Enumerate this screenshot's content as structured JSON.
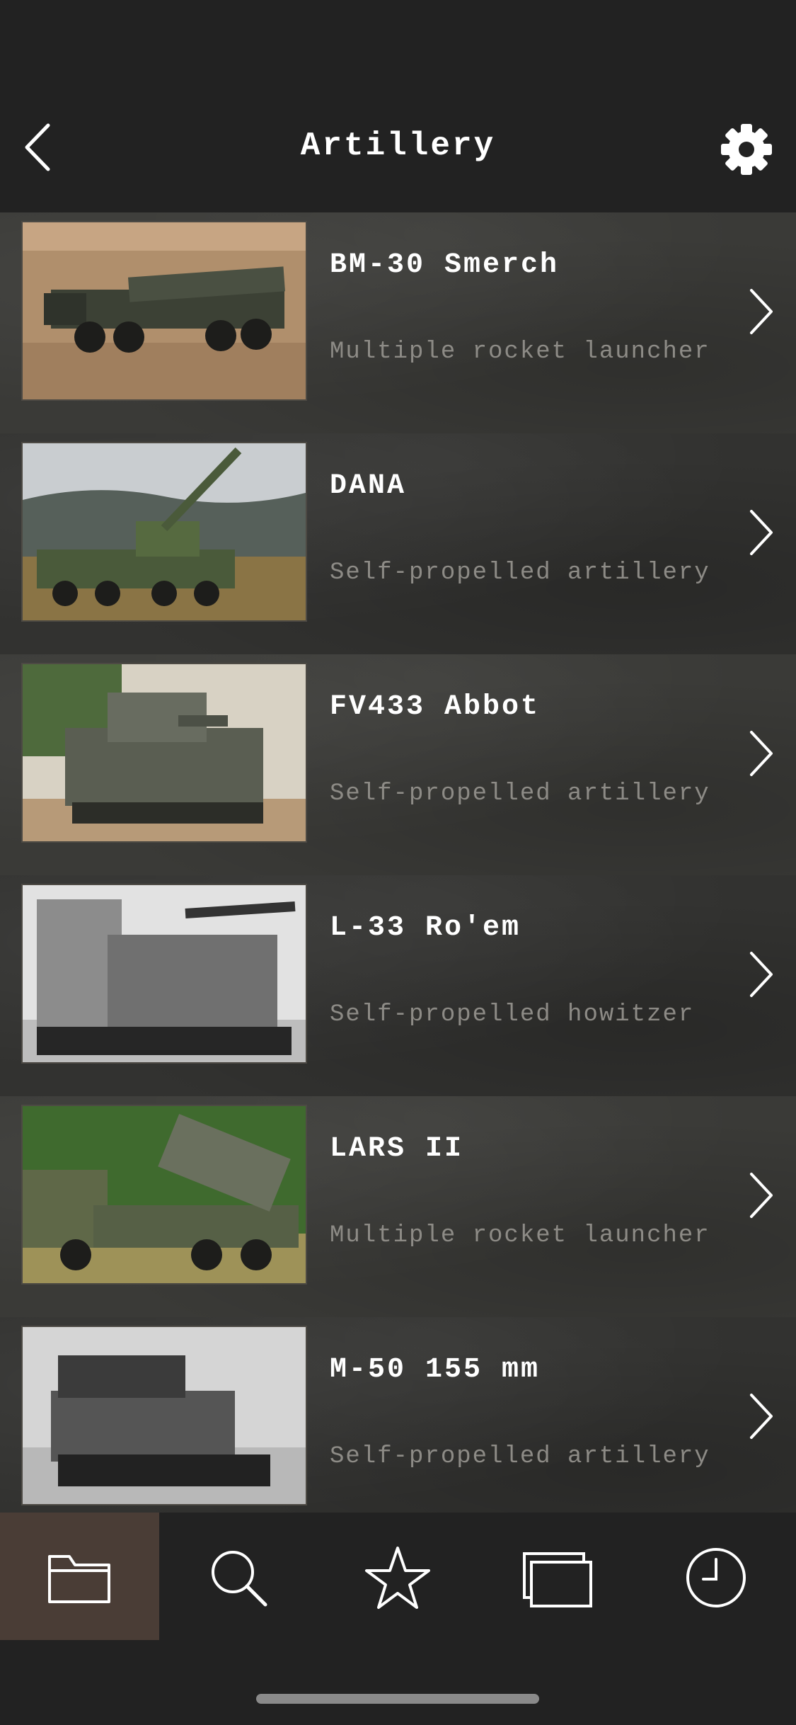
{
  "header": {
    "title": "Artillery",
    "back_icon": "chevron-left-icon",
    "settings_icon": "gear-icon"
  },
  "items": [
    {
      "title": "BM-30 Smerch",
      "subtitle": "Multiple rocket launcher",
      "image": "rocket-launcher-truck-photo"
    },
    {
      "title": "DANA",
      "subtitle": "Self-propelled artillery",
      "image": "wheeled-howitzer-photo"
    },
    {
      "title": "FV433 Abbot",
      "subtitle": "Self-propelled artillery",
      "image": "tracked-spg-photo"
    },
    {
      "title": "L-33 Ro'em",
      "subtitle": "Self-propelled howitzer",
      "image": "bw-howitzer-photo"
    },
    {
      "title": "LARS II",
      "subtitle": "Multiple rocket launcher",
      "image": "camo-rocket-truck-photo"
    },
    {
      "title": "M-50 155 mm",
      "subtitle": "Self-propelled artillery",
      "image": "bw-halftrack-spg-photo"
    }
  ],
  "tabbar": {
    "tabs": [
      {
        "name": "catalog",
        "icon": "folder-icon",
        "active": true
      },
      {
        "name": "search",
        "icon": "search-icon",
        "active": false
      },
      {
        "name": "favorites",
        "icon": "star-icon",
        "active": false
      },
      {
        "name": "compare",
        "icon": "windows-icon",
        "active": false
      },
      {
        "name": "history",
        "icon": "clock-icon",
        "active": false
      }
    ]
  },
  "colors": {
    "background": "#222222",
    "row": "#3a3a37",
    "title_text": "#ffffff",
    "subtitle_text": "#8d8b86",
    "active_tab": "#4a3d36"
  }
}
